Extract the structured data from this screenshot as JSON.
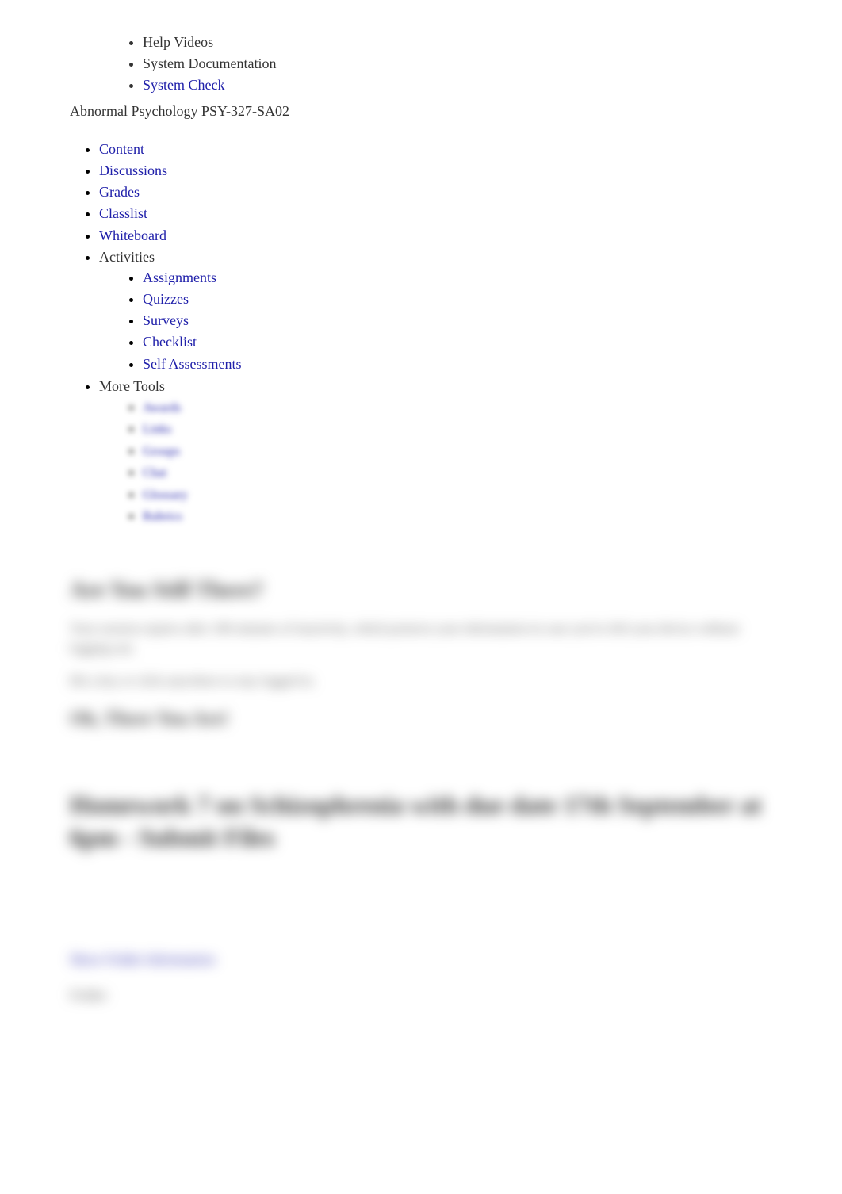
{
  "help": {
    "items": [
      {
        "label": "Help Videos",
        "link": false
      },
      {
        "label": "System Documentation",
        "link": false
      },
      {
        "label": "System Check",
        "link": true
      }
    ]
  },
  "course": {
    "title": "Abnormal Psychology PSY-327-SA02"
  },
  "nav": {
    "content": "Content",
    "discussions": "Discussions",
    "grades": "Grades",
    "classlist": "Classlist",
    "whiteboard": "Whiteboard",
    "activities": "Activities",
    "activities_sub": {
      "assignments": "Assignments",
      "quizzes": "Quizzes",
      "surveys": "Surveys",
      "checklist": "Checklist",
      "self_assessments": "Self Assessments"
    },
    "more_tools": "More Tools",
    "more_tools_sub": [
      "Awards",
      "Links",
      "Groups",
      "Chat",
      "Glossary",
      "Rubrics"
    ]
  },
  "blurred": {
    "heading1": "Are You Still There?",
    "para1": "Your session expires after 180 minutes of inactivity, which protects your information in case you've left your device without logging out.",
    "para2": "Hit a key or click anywhere to stay logged in.",
    "heading2": "Oh, There You Are!",
    "heading3": "Homework 7 on Schizophrenia with due date 17th September at 6pm - Submit Files",
    "link": "Show Folder Information",
    "small": "Folder"
  }
}
